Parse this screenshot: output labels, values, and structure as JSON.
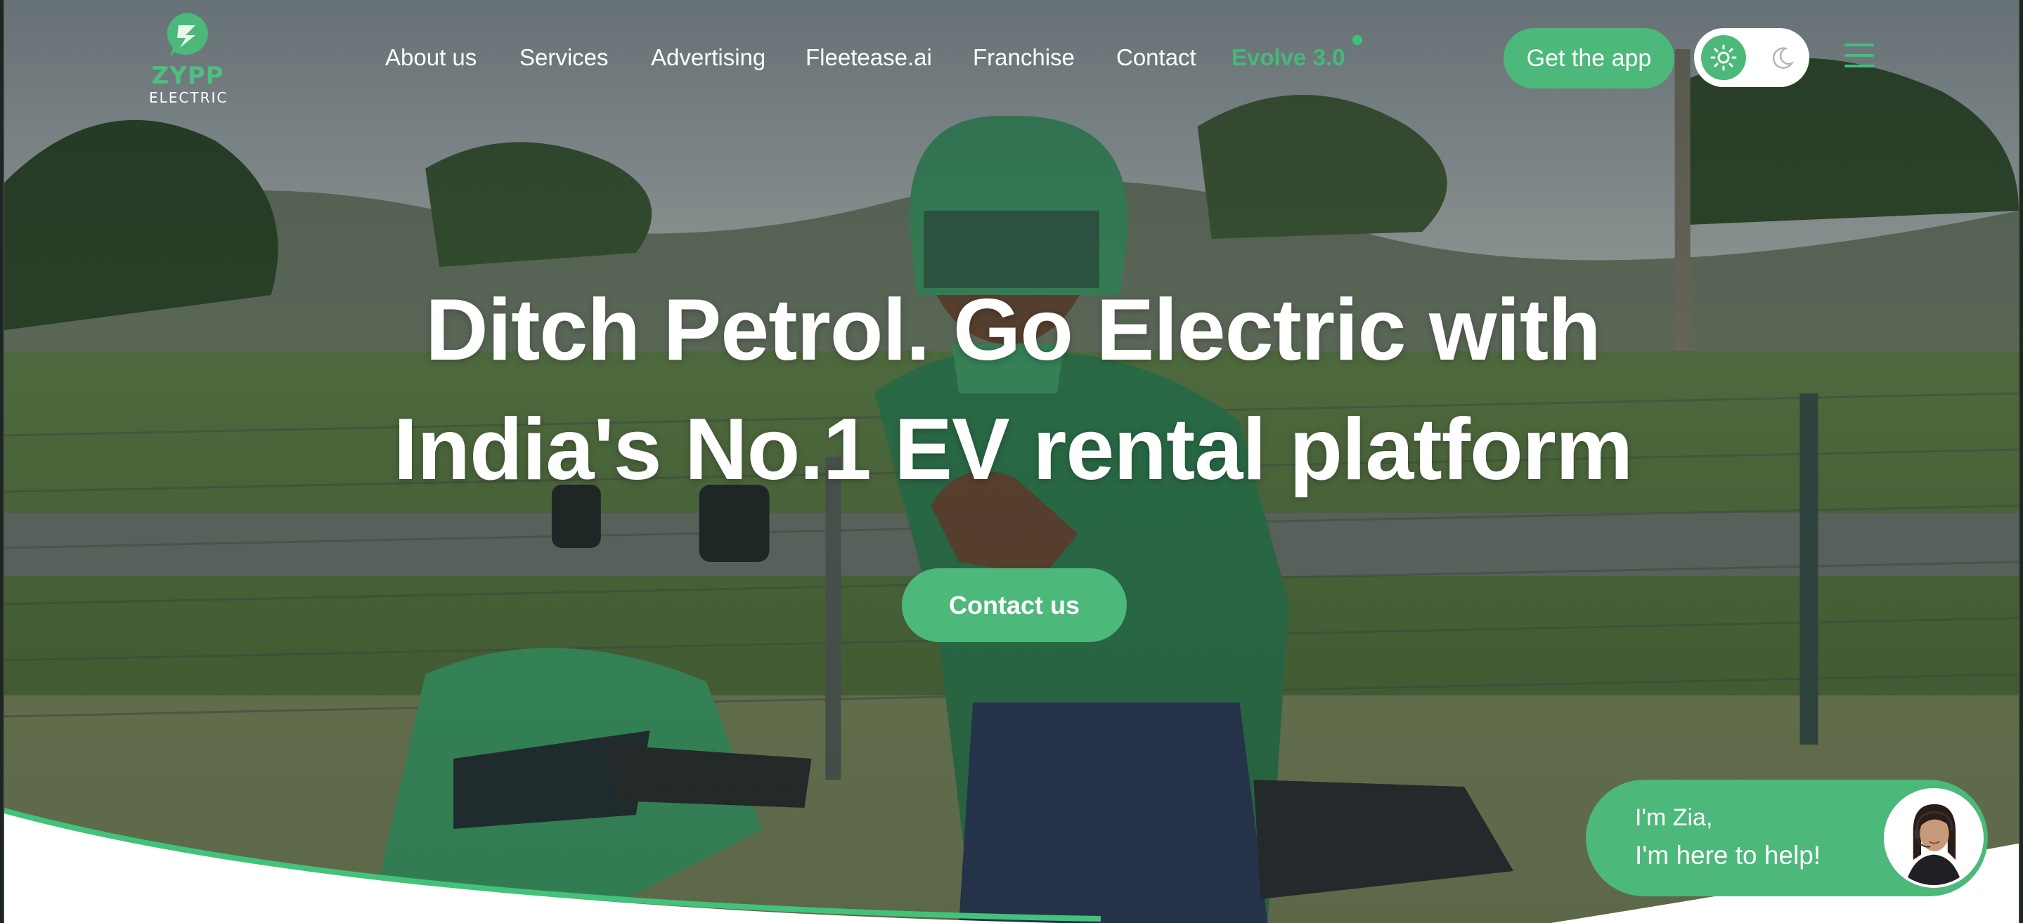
{
  "brand": {
    "logo_word": "ZYPP",
    "logo_sub": "ELECTRIC",
    "primary_color": "#4cb87a",
    "logo_icon": "zypp-bolt-logo-icon"
  },
  "nav": {
    "links": [
      "About us",
      "Services",
      "Advertising",
      "Fleetease.ai",
      "Franchise",
      "Contact"
    ],
    "highlight_link": "Evolve 3.0",
    "get_app_label": "Get the app",
    "theme_toggle": {
      "active": "light",
      "icons": [
        "sun-icon",
        "moon-icon"
      ]
    },
    "menu_icon": "hamburger-menu-icon"
  },
  "hero": {
    "headline_line1": "Ditch Petrol. Go Electric with",
    "headline_line2": "India's No.1 EV rental platform",
    "cta_label": "Contact us"
  },
  "chat_widget": {
    "line1": "I'm Zia,",
    "line2": "I'm here to help!",
    "avatar_icon": "support-agent-avatar"
  }
}
